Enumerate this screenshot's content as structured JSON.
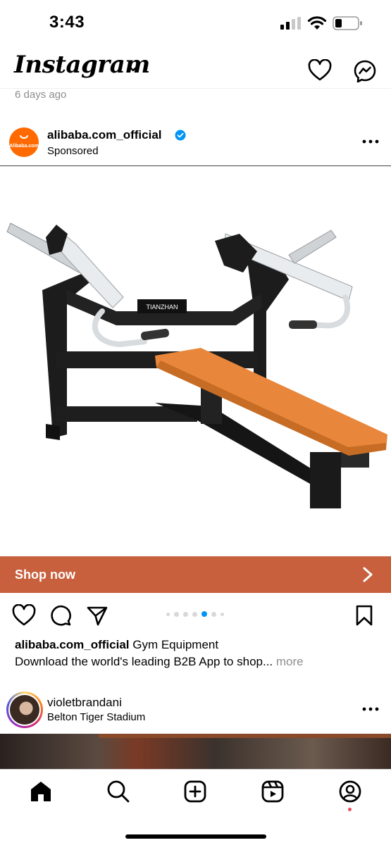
{
  "status_bar": {
    "time": "3:43"
  },
  "header": {
    "logo": "Instagram",
    "icons": [
      "chevron-down-icon",
      "heart-icon",
      "messenger-icon"
    ]
  },
  "previous_post": {
    "time_ago": "6 days ago"
  },
  "post": {
    "avatar_text": "Alibaba.com",
    "username": "alibaba.com_official",
    "label": "Sponsored",
    "image_alt_text": "TIANZHAN",
    "cta": "Shop now",
    "carousel": {
      "count": 7,
      "active": 4
    },
    "caption_user": "alibaba.com_official",
    "caption_text": " Gym Equipment",
    "caption_line2": "Download the world's leading B2B App to shop... ",
    "caption_more": "more",
    "colors": {
      "cta_bg": "#c85f3d",
      "bench_seat": "#e8873c",
      "active_dot": "#0095f6"
    }
  },
  "next_post": {
    "username": "violetbrandani",
    "location": "Belton Tiger Stadium"
  },
  "tab_bar": {
    "items": [
      "home-icon",
      "search-icon",
      "create-icon",
      "reels-icon",
      "profile-icon"
    ]
  }
}
